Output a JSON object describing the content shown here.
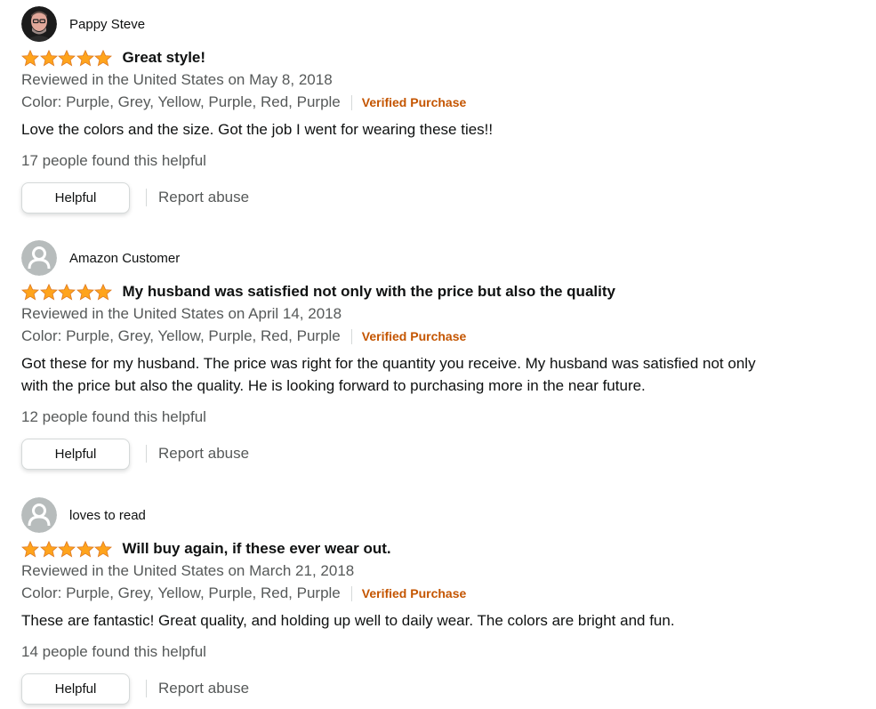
{
  "reviews": [
    {
      "profile_name": "Pappy Steve",
      "avatar": "photo-avatar",
      "rating": 5,
      "title": "Great style!",
      "date": "Reviewed in the United States on May 8, 2018",
      "variant": "Color: Purple, Grey, Yellow, Purple, Red, Purple",
      "verified": "Verified Purchase",
      "body": "Love the colors and the size. Got the job I went for wearing these ties!!",
      "helpful_count": "17 people found this helpful",
      "helpful_button": "Helpful",
      "report": "Report abuse"
    },
    {
      "profile_name": "Amazon Customer",
      "avatar": "default-avatar",
      "rating": 5,
      "title": "My husband was satisfied not only with the price but also the quality",
      "date": "Reviewed in the United States on April 14, 2018",
      "variant": "Color: Purple, Grey, Yellow, Purple, Red, Purple",
      "verified": "Verified Purchase",
      "body": "Got these for my husband. The price was right for the quantity you receive. My husband was satisfied not only with the price but also the quality. He is looking forward to purchasing more in the near future.",
      "helpful_count": "12 people found this helpful",
      "helpful_button": "Helpful",
      "report": "Report abuse"
    },
    {
      "profile_name": "loves to read",
      "avatar": "default-avatar",
      "rating": 5,
      "title": "Will buy again, if these ever wear out.",
      "date": "Reviewed in the United States on March 21, 2018",
      "variant": "Color: Purple, Grey, Yellow, Purple, Red, Purple",
      "verified": "Verified Purchase",
      "body": "These are fantastic! Great quality, and holding up well to daily wear. The colors are bright and fun.",
      "helpful_count": "14 people found this helpful",
      "helpful_button": "Helpful",
      "report": "Report abuse"
    }
  ],
  "colors": {
    "star": "#ffa41c",
    "verified": "#c45500",
    "secondary_text": "#565959"
  }
}
